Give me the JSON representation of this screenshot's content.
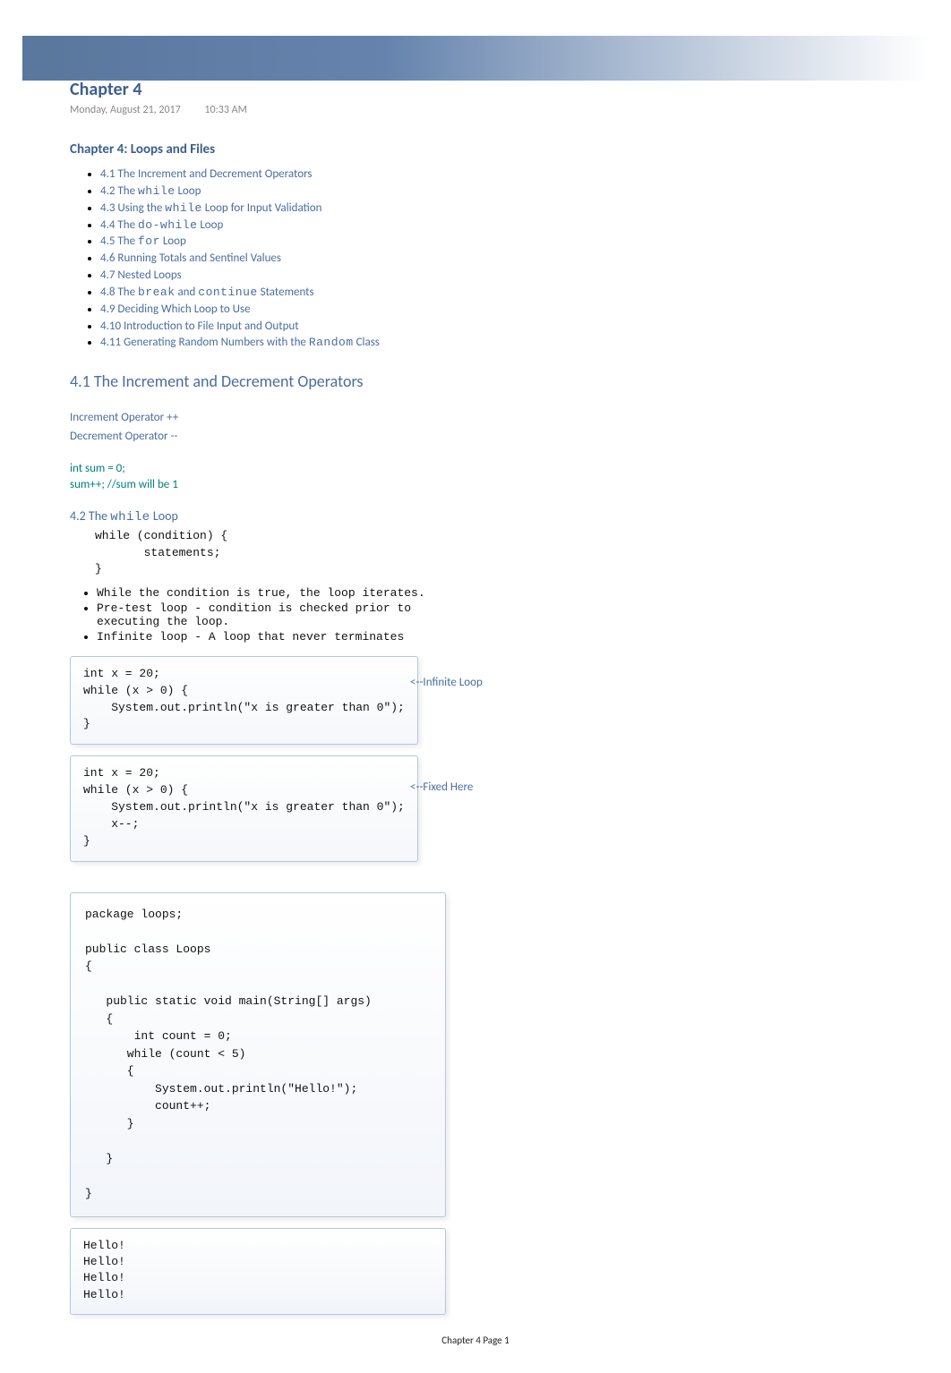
{
  "title": "Chapter 4",
  "date": "Monday, August 21, 2017",
  "time": "10:33 AM",
  "subheading": "Chapter 4: Loops and Files",
  "toc": [
    {
      "pre": "4.1 The Increment and Decrement Operators"
    },
    {
      "pre": "4.2 The ",
      "mono": "while",
      "post": " Loop"
    },
    {
      "pre": "4.3 Using the ",
      "mono": "while",
      "post": " Loop for Input Validation"
    },
    {
      "pre": "4.4 The ",
      "mono": "do-while",
      "post": " Loop"
    },
    {
      "pre": "4.5 The ",
      "mono": "for",
      "post": " Loop"
    },
    {
      "pre": "4.6 Running Totals and Sentinel Values"
    },
    {
      "pre": "4.7 Nested Loops"
    },
    {
      "pre": "4.8 The ",
      "mono": "break",
      "mid": " and ",
      "mono2": "continue",
      "post": " Statements"
    },
    {
      "pre": "4.9 Deciding Which Loop to Use"
    },
    {
      "pre": "4.10 Introduction to File Input and Output"
    },
    {
      "pre": "4.11 Generating Random Numbers with the ",
      "mono": "Random",
      "post": " Class"
    }
  ],
  "section41_title": "4.1  The Increment and Decrement Operators",
  "inc_label": "Increment Operator    ++",
  "dec_label": "Decrement Operator  --",
  "intsum_line1": "int sum  = 0;",
  "intsum_line2": "sum++; //sum will be 1",
  "section42_pre": "4.2 The ",
  "section42_mono": "while",
  "section42_post": " Loop",
  "while_syntax": "while (condition) {\n       statements;\n}",
  "notes": [
    "While the condition is true, the loop iterates.",
    "Pre-test loop - condition is checked prior to\nexecuting the loop.",
    "Infinite loop - A loop that never terminates"
  ],
  "code1": "int x = 20;\nwhile (x > 0) {\n    System.out.println(\"x is greater than 0\");\n}",
  "annot1": "<--Infinite Loop",
  "code2": "int x = 20;\nwhile (x > 0) {\n    System.out.println(\"x is greater than 0\");\n    x--;\n}",
  "annot2": "<--Fixed Here",
  "code3": "package loops;\n\npublic class Loops\n{\n\n   public static void main(String[] args)\n   {\n       int count = 0;\n      while (count < 5)\n      {\n          System.out.println(\"Hello!\");\n          count++;\n      }\n     \n   }\n\n}",
  "output": "Hello!\nHello!\nHello!\nHello!",
  "footer": "Chapter 4 Page 1"
}
